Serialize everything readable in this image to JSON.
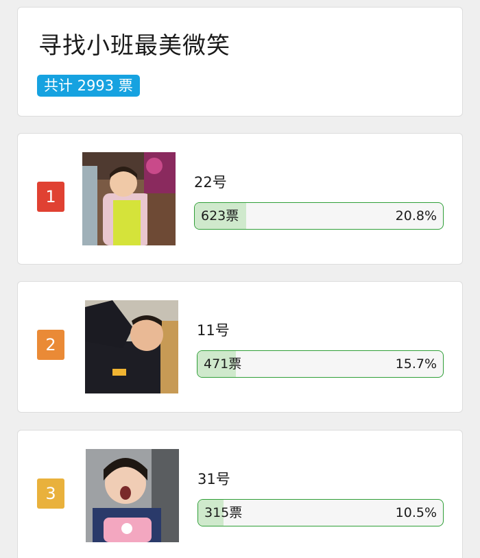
{
  "header": {
    "title": "寻找小班最美微笑",
    "total_label": "共计 2993 票"
  },
  "entries": [
    {
      "rank": "1",
      "name": "22号",
      "votes_label": "623票",
      "percent_label": "20.8%",
      "share": 0.208,
      "rank_color": "#e04132",
      "photo_icon": "photo-icon"
    },
    {
      "rank": "2",
      "name": "11号",
      "votes_label": "471票",
      "percent_label": "15.7%",
      "share": 0.157,
      "rank_color": "#ea8a36",
      "photo_icon": "photo-icon"
    },
    {
      "rank": "3",
      "name": "31号",
      "votes_label": "315票",
      "percent_label": "10.5%",
      "share": 0.105,
      "rank_color": "#e9b13c",
      "photo_icon": "photo-icon"
    }
  ],
  "colors": {
    "badge": "#16a2e0",
    "bar_border": "#2e9e36",
    "bar_fill": "#cfe9cc"
  }
}
